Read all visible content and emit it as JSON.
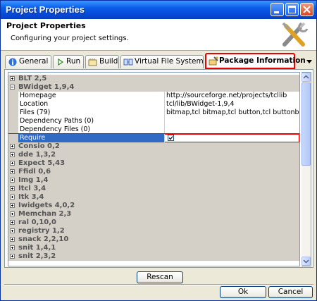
{
  "window": {
    "title": "Project Properties"
  },
  "header": {
    "title": "Project Properties",
    "description": "Configuring your project settings."
  },
  "tabs": [
    {
      "label": "General",
      "icon": "info-icon"
    },
    {
      "label": "Run",
      "icon": "play-icon"
    },
    {
      "label": "Build",
      "icon": "build-icon"
    },
    {
      "label": "Virtual File System",
      "icon": "vfs-icon"
    },
    {
      "label": "Package Information",
      "icon": "package-icon",
      "active": true
    }
  ],
  "tree": {
    "packages": [
      {
        "name": "BLT 2,5",
        "expanded": false
      },
      {
        "name": "BWidget 1,9,4",
        "expanded": true
      },
      {
        "name": "Consio 0,2",
        "expanded": false
      },
      {
        "name": "dde 1,3,2",
        "expanded": false
      },
      {
        "name": "Expect 5,43",
        "expanded": false
      },
      {
        "name": "Ffidl 0,6",
        "expanded": false
      },
      {
        "name": "Img 1,4",
        "expanded": false
      },
      {
        "name": "Itcl 3,4",
        "expanded": false
      },
      {
        "name": "Itk 3,4",
        "expanded": false
      },
      {
        "name": "Iwidgets 4,0,2",
        "expanded": false
      },
      {
        "name": "Memchan 2,3",
        "expanded": false
      },
      {
        "name": "ral 0,10,0",
        "expanded": false
      },
      {
        "name": "registry 1,2",
        "expanded": false
      },
      {
        "name": "snack 2,2,10",
        "expanded": false
      },
      {
        "name": "snit 1,4,1",
        "expanded": false
      },
      {
        "name": "snit 2,3,2",
        "expanded": false
      }
    ],
    "properties": [
      {
        "key": "Homepage",
        "value": "http://sourceforge.net/projects/tcllib"
      },
      {
        "key": "Location",
        "value": "tcl/lib/BWidget-1,9,4"
      },
      {
        "key": "Files (79)",
        "value": "bitmap,tcl bitmap,tcl button,tcl buttonbox,tcl color"
      },
      {
        "key": "Dependency Paths (0)",
        "value": ""
      },
      {
        "key": "Dependency Files (0)",
        "value": ""
      },
      {
        "key": "Require",
        "value": "",
        "checked": true
      }
    ]
  },
  "buttons": {
    "rescan": "Rescan",
    "ok": "Ok",
    "cancel": "Cancel"
  },
  "colors": {
    "highlight": "#e00000",
    "selection": "#316ac5",
    "titlebar": "#0a5ce8"
  }
}
